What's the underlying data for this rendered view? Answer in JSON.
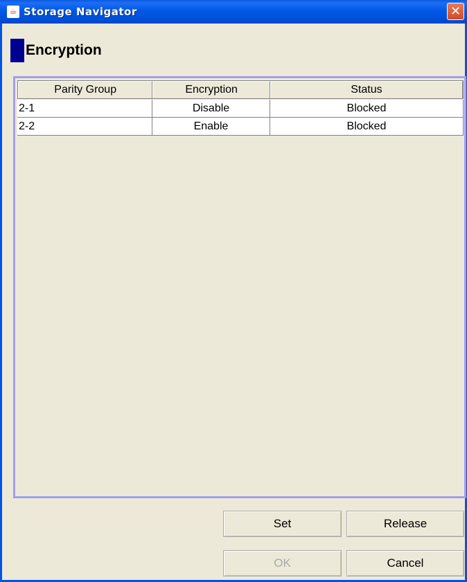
{
  "window": {
    "title": "Storage Navigator",
    "close_glyph": "✕",
    "app_icon": "java-icon"
  },
  "section": {
    "title": "Encryption"
  },
  "table": {
    "columns": [
      "Parity Group",
      "Encryption",
      "Status"
    ],
    "rows": [
      {
        "parity_group": "2-1",
        "encryption": "Disable",
        "status": "Blocked"
      },
      {
        "parity_group": "2-2",
        "encryption": "Enable",
        "status": "Blocked"
      }
    ]
  },
  "buttons": {
    "set": "Set",
    "release": "Release",
    "ok": "OK",
    "cancel": "Cancel"
  },
  "colors": {
    "titlebar": "#0058e6",
    "section_marker": "#000090",
    "frame_border": "#a0a0e8",
    "background": "#ece9d8"
  }
}
